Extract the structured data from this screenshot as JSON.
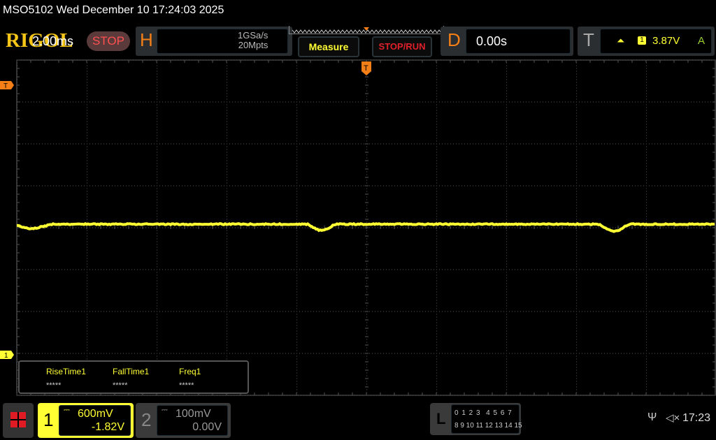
{
  "title": "MSO5102  Wed December 10 17:24:03 2025",
  "logo": "RIGOL",
  "run_status": "STOP",
  "horizontal": {
    "letter": "H",
    "timebase": "2.00ms",
    "sample_rate": "1GSa/s",
    "memory_depth": "20Mpts"
  },
  "buttons": {
    "measure": "Measure",
    "stop_run": "STOP/RUN"
  },
  "delay": {
    "letter": "D",
    "value": "0.00s"
  },
  "trigger": {
    "letter": "T",
    "source": "1",
    "level": "3.87V",
    "mode": "A",
    "edge_icon": "rising-edge-icon"
  },
  "markers": {
    "trigger_level": "T",
    "channel1": "1",
    "trigger_position": "T"
  },
  "measurements": [
    {
      "label": "RiseTime1",
      "value": "*****"
    },
    {
      "label": "FallTime1",
      "value": "*****"
    },
    {
      "label": "Freq1",
      "value": "*****"
    }
  ],
  "channel1": {
    "number": "1",
    "scale": "600mV",
    "offset": "-1.82V",
    "coupling_icon": "dc-coupling-icon",
    "color": "#ffff33"
  },
  "channel2": {
    "number": "2",
    "scale": "100mV",
    "offset": "0.00V",
    "coupling_icon": "dc-coupling-icon"
  },
  "logic": {
    "letter": "L",
    "row1": "0 1 2 3  4 5 6 7",
    "row2": "8 9 10 11 12 13 14 15"
  },
  "status": {
    "clock": "17:23",
    "usb_icon": "usb-icon",
    "sound_icon": "mute-icon"
  },
  "colors": {
    "accent": "#f57f17",
    "trace": "#ffff33",
    "stop": "#ff5050"
  }
}
